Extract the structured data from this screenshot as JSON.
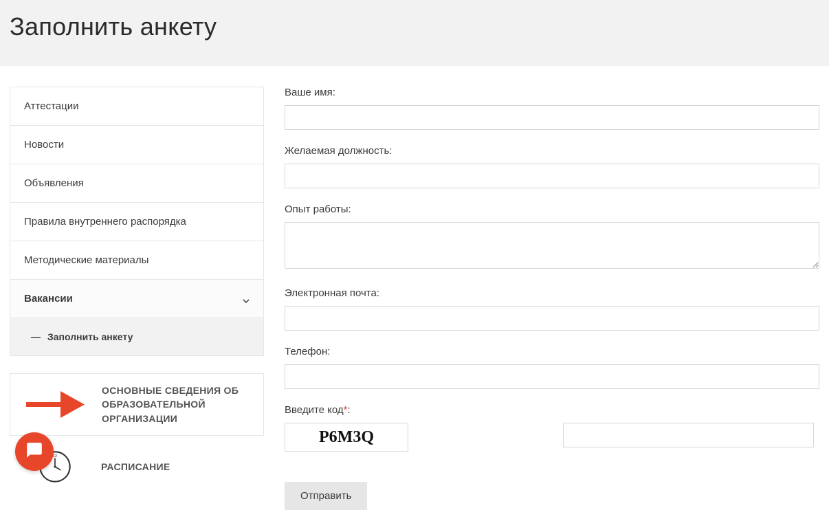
{
  "header": {
    "title": "Заполнить анкету"
  },
  "sidebar": {
    "items": [
      {
        "label": "Аттестации"
      },
      {
        "label": "Новости"
      },
      {
        "label": "Объявления"
      },
      {
        "label": "Правила внутреннего распорядка"
      },
      {
        "label": "Методические материалы"
      },
      {
        "label": "Вакансии"
      },
      {
        "label": "Заполнить анкету"
      }
    ],
    "info_card_1": "ОСНОВНЫЕ СВЕДЕНИЯ ОБ ОБРАЗОВАТЕЛЬНОЙ ОРГАНИЗАЦИИ",
    "info_card_2": "РАСПИСАНИЕ"
  },
  "form": {
    "name_label": "Ваше имя:",
    "position_label": "Желаемая должность:",
    "experience_label": "Опыт работы:",
    "email_label": "Электронная почта:",
    "phone_label": "Телефон:",
    "captcha_label": "Введите код",
    "captcha_text": "P6M3Q",
    "submit_label": "Отправить",
    "required_star": "*"
  }
}
